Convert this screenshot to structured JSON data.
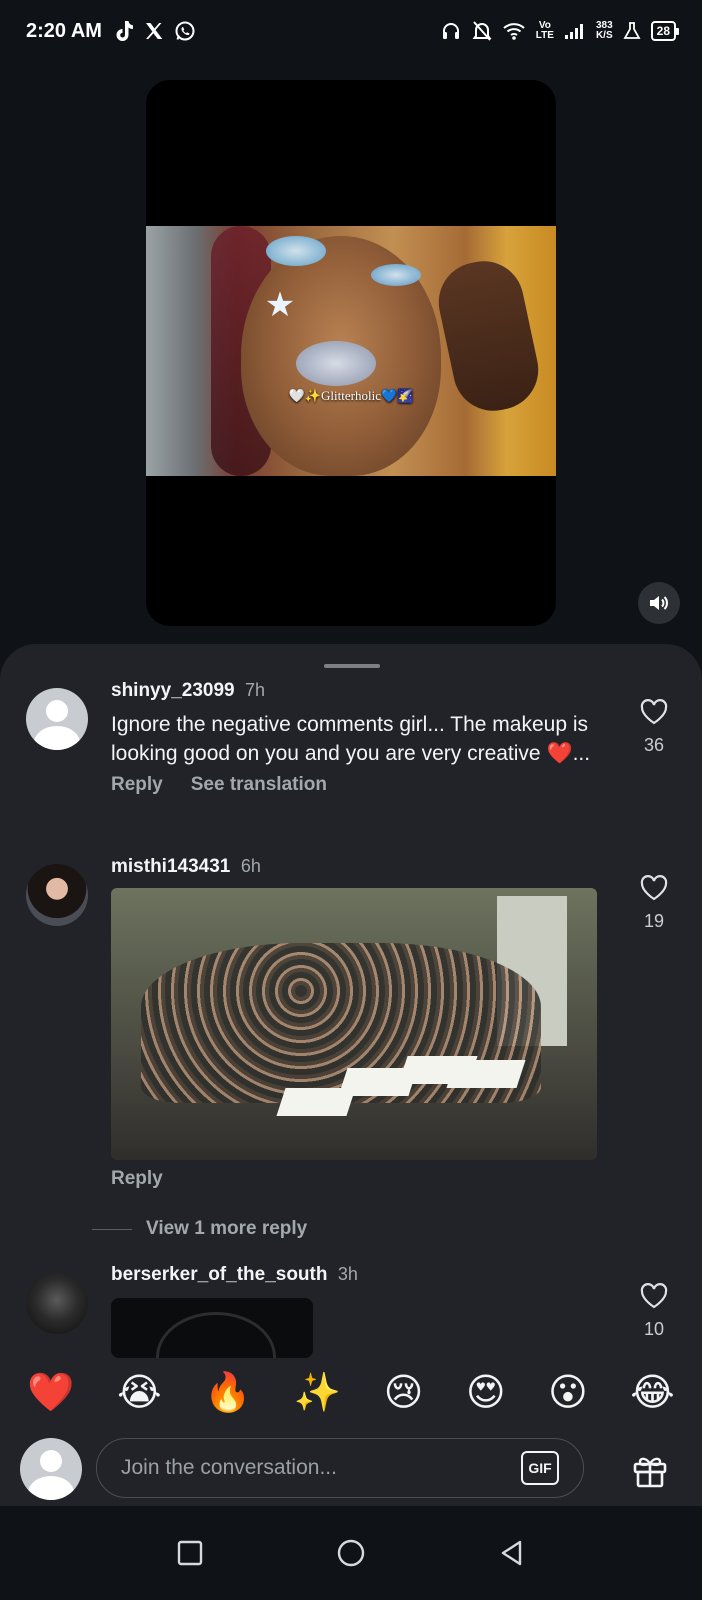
{
  "status_bar": {
    "time": "2:20 AM",
    "apps": [
      "tiktok-icon",
      "x-icon",
      "whatsapp-icon"
    ],
    "net_type_top": "Vo",
    "net_type_bottom": "LTE",
    "speed_value": "383",
    "speed_unit": "K/S",
    "battery": "28"
  },
  "video": {
    "caption": "🤍✨Glitterholic💙🌠",
    "sound_icon": "speaker-icon"
  },
  "comments": [
    {
      "username": "shinyy_23099",
      "time": "7h",
      "text": "Ignore the negative comments girl... The makeup is looking good on you and you are very creative ❤️...",
      "reply": "Reply",
      "see_translation": "See translation",
      "likes": "36"
    },
    {
      "username": "misthi143431",
      "time": "6h",
      "reply": "Reply",
      "likes": "19",
      "view_more": "View 1 more reply"
    },
    {
      "username": "berserker_of_the_south",
      "time": "3h",
      "likes": "10"
    }
  ],
  "emoji_bar": [
    "❤️",
    "😭",
    "🔥",
    "✨",
    "😢",
    "😍",
    "😮",
    "😂"
  ],
  "composer": {
    "placeholder": "Join the conversation...",
    "gif_label": "GIF"
  },
  "colors": {
    "sheet_bg": "#212328",
    "page_bg": "#0f1216",
    "muted_text": "#a3a8ae"
  }
}
